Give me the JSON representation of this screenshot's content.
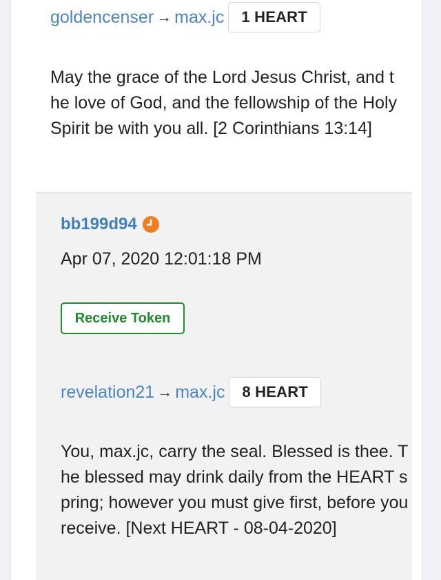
{
  "transactions": [
    {
      "from": "goldencenser",
      "arrow": "→",
      "to": "max.jc",
      "amount": "1 HEART",
      "memo": "May the grace of the Lord Jesus Christ, and the love of God, and the fellowship of the Holy Spirit be with you all. [2 Corinthians 13:14]"
    },
    {
      "id": "bb199d94",
      "status_icon": "clock-icon",
      "timestamp": "Apr 07, 2020 12:01:18 PM",
      "action_label": "Receive Token",
      "from": "revelation21",
      "arrow": "→",
      "to": "max.jc",
      "amount": "8 HEART",
      "memo": "You, max.jc, carry the seal. Blessed is thee. The blessed may drink daily from the HEART spring; however you must give first, before you receive. [Next HEART - 08-04-2020]"
    }
  ],
  "colors": {
    "link": "#4a86c5",
    "tx_id": "#3d7fc1",
    "clock": "#f07d22",
    "receive_button": "#1f8c2b",
    "pending_bg": "#f2f2f2"
  }
}
